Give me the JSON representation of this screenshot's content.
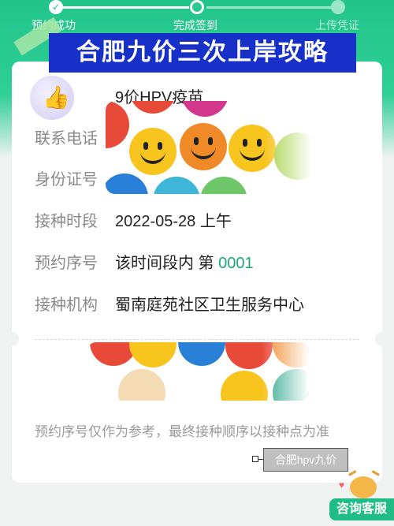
{
  "progress": {
    "steps": [
      {
        "label": "预约成功",
        "state": "done"
      },
      {
        "label": "完成签到",
        "state": "current"
      },
      {
        "label": "上传凭证",
        "state": "pending"
      }
    ]
  },
  "banner": {
    "text": "合肥九价三次上岸攻略"
  },
  "vaccine": {
    "name": "9价HPV疫苗",
    "icon": "thumbs-up-icon"
  },
  "details": {
    "phone_label": "联系电话",
    "id_label": "身份证号",
    "time_label": "接种时段",
    "time_value": "2022-05-28 上午",
    "seq_label": "预约序号",
    "seq_prefix": "该时间段内 第",
    "seq_number": "0001",
    "org_label": "接种机构",
    "org_value": "蜀南庭苑社区卫生服务中心"
  },
  "note": "预约序号仅作为参考，最终接种顺序以接种点为准",
  "tag": {
    "text": "合肥hpv九价"
  },
  "service_button": {
    "label": "咨询客服"
  },
  "colors": {
    "accent": "#21c48a",
    "banner": "#1730c8",
    "sequence": "#1ea57b"
  }
}
